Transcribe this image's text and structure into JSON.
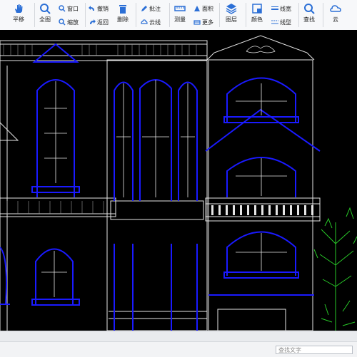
{
  "toolbar": {
    "pan": "平移",
    "fit": "全图",
    "window": "窗口",
    "zoom": "缩放",
    "undo": "撤销",
    "back": "返回",
    "delete": "删除",
    "annotate": "批注",
    "cloudline": "云线",
    "measure": "测量",
    "area": "面积",
    "more": "更多",
    "layers": "图层",
    "color": "颜色",
    "linewidth": "线宽",
    "linetype": "线型",
    "find": "查找",
    "cloud": "云"
  },
  "status": {
    "search_placeholder": "查找文字"
  },
  "colors": {
    "accent": "#2b6fd6",
    "cad_blue": "#1a1aff",
    "cad_white": "#e6e6e6",
    "tree_green": "#28c828"
  }
}
